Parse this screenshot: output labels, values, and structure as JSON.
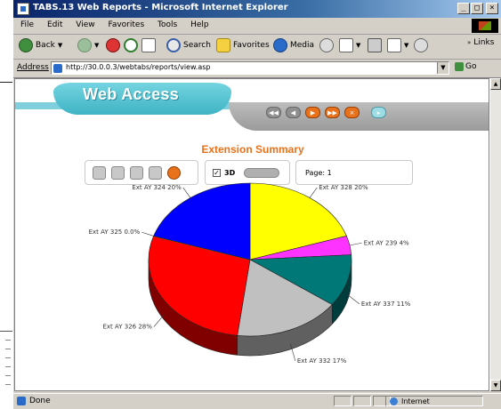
{
  "window": {
    "title": "TABS.13 Web Reports - Microsoft Internet Explorer",
    "controls": [
      "_",
      "□",
      "×"
    ]
  },
  "menu": [
    "File",
    "Edit",
    "View",
    "Favorites",
    "Tools",
    "Help"
  ],
  "toolbar": {
    "back": "Back",
    "search": "Search",
    "favorites": "Favorites",
    "media": "Media",
    "links": "Links"
  },
  "address": {
    "label": "Address",
    "url": "http://30.0.0.3/webtabs/reports/view.asp",
    "go": "Go"
  },
  "site": {
    "title": "Web Access"
  },
  "report": {
    "title": "Extension Summary",
    "three_d_label": "3D",
    "three_d_checked": true,
    "page_label": "Page: 1"
  },
  "chart_data": {
    "type": "pie",
    "title": "Extension Summary",
    "slices": [
      {
        "label": "Ext AY 328 20%",
        "value": 20,
        "color": "#ffff00"
      },
      {
        "label": "Ext AY 239 4%",
        "value": 4,
        "color": "#ff33ff"
      },
      {
        "label": "Ext AY 337 11%",
        "value": 11,
        "color": "#007878"
      },
      {
        "label": "Ext AY 332 17%",
        "value": 17,
        "color": "#c0c0c0"
      },
      {
        "label": "Ext AY 326 28%",
        "value": 28,
        "color": "#ff0000"
      },
      {
        "label": "Ext AY 325 0.0%",
        "value": 0,
        "color": "#00a000"
      },
      {
        "label": "Ext AY 324 20%",
        "value": 20,
        "color": "#0000ff"
      }
    ]
  },
  "status": {
    "left": "Done",
    "zone": "Internet"
  }
}
